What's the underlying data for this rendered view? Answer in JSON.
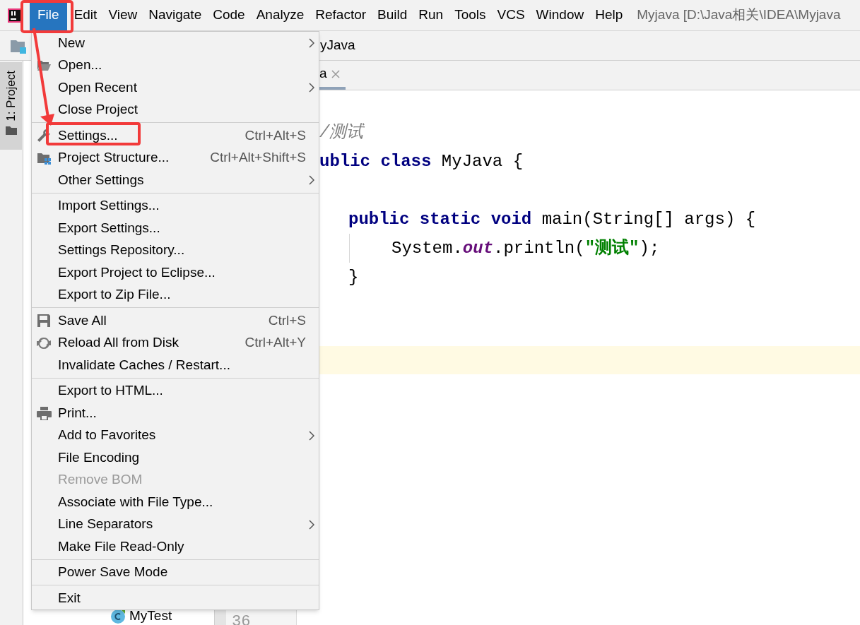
{
  "window": {
    "title": "Myjava [D:\\Java相关\\IDEA\\Myjava"
  },
  "menu_bar": [
    {
      "label": "File",
      "selected": true
    },
    {
      "label": "Edit",
      "selected": false
    },
    {
      "label": "View",
      "selected": false
    },
    {
      "label": "Navigate",
      "selected": false
    },
    {
      "label": "Code",
      "selected": false
    },
    {
      "label": "Analyze",
      "selected": false
    },
    {
      "label": "Refactor",
      "selected": false
    },
    {
      "label": "Build",
      "selected": false
    },
    {
      "label": "Run",
      "selected": false
    },
    {
      "label": "Tools",
      "selected": false
    },
    {
      "label": "VCS",
      "selected": false
    },
    {
      "label": "Window",
      "selected": false
    },
    {
      "label": "Help",
      "selected": false
    }
  ],
  "breadcrumb": "yJava",
  "editor_tab": {
    "label": "a"
  },
  "tool_window_tab": {
    "label": "1: Project"
  },
  "project_tree": [
    {
      "label": "MyTest"
    }
  ],
  "gutter": {
    "line_number": "36"
  },
  "code_lines": [
    {
      "kind": "code",
      "tokens": [
        {
          "kind": "comment",
          "text": "/测试"
        }
      ]
    },
    {
      "kind": "code",
      "tokens": [
        {
          "kind": "keyword",
          "text": "ublic class"
        },
        {
          "kind": "plain",
          "text": " MyJava {"
        }
      ],
      "children": [
        {
          "kind": "blank"
        },
        {
          "kind": "code",
          "tokens": [
            {
              "kind": "keyword",
              "text": "public static void"
            },
            {
              "kind": "plain",
              "text": " main(String[] args) {"
            }
          ],
          "children": [
            {
              "kind": "code",
              "tokens": [
                {
                  "kind": "plain",
                  "text": "System."
                },
                {
                  "kind": "static_field",
                  "text": "out"
                },
                {
                  "kind": "plain",
                  "text": ".println("
                },
                {
                  "kind": "string",
                  "text": "\"测试\""
                },
                {
                  "kind": "plain",
                  "text": ");"
                }
              ]
            }
          ]
        },
        {
          "kind": "code",
          "tokens": [
            {
              "kind": "plain",
              "text": "}"
            }
          ]
        }
      ]
    }
  ],
  "file_menu": [
    {
      "kind": "item",
      "label": "New",
      "submenu": true,
      "disabled": false
    },
    {
      "kind": "item",
      "label": "Open...",
      "submenu": false,
      "disabled": false
    },
    {
      "kind": "item",
      "label": "Open Recent",
      "submenu": true,
      "disabled": false
    },
    {
      "kind": "item",
      "label": "Close Project",
      "submenu": false,
      "disabled": false
    },
    {
      "kind": "separator"
    },
    {
      "kind": "item",
      "label": "Settings...",
      "shortcut": "Ctrl+Alt+S",
      "submenu": false,
      "disabled": false
    },
    {
      "kind": "item",
      "label": "Project Structure...",
      "shortcut": "Ctrl+Alt+Shift+S",
      "submenu": false,
      "disabled": false
    },
    {
      "kind": "item",
      "label": "Other Settings",
      "submenu": true,
      "disabled": false
    },
    {
      "kind": "separator"
    },
    {
      "kind": "item",
      "label": "Import Settings...",
      "submenu": false,
      "disabled": false
    },
    {
      "kind": "item",
      "label": "Export Settings...",
      "submenu": false,
      "disabled": false
    },
    {
      "kind": "item",
      "label": "Settings Repository...",
      "submenu": false,
      "disabled": false
    },
    {
      "kind": "item",
      "label": "Export Project to Eclipse...",
      "submenu": false,
      "disabled": false
    },
    {
      "kind": "item",
      "label": "Export to Zip File...",
      "submenu": false,
      "disabled": false
    },
    {
      "kind": "separator"
    },
    {
      "kind": "item",
      "label": "Save All",
      "shortcut": "Ctrl+S",
      "submenu": false,
      "disabled": false
    },
    {
      "kind": "item",
      "label": "Reload All from Disk",
      "shortcut": "Ctrl+Alt+Y",
      "submenu": false,
      "disabled": false
    },
    {
      "kind": "item",
      "label": "Invalidate Caches / Restart...",
      "submenu": false,
      "disabled": false
    },
    {
      "kind": "separator"
    },
    {
      "kind": "item",
      "label": "Export to HTML...",
      "submenu": false,
      "disabled": false
    },
    {
      "kind": "item",
      "label": "Print...",
      "submenu": false,
      "disabled": false
    },
    {
      "kind": "item",
      "label": "Add to Favorites",
      "submenu": true,
      "disabled": false
    },
    {
      "kind": "item",
      "label": "File Encoding",
      "submenu": false,
      "disabled": false
    },
    {
      "kind": "item",
      "label": "Remove BOM",
      "submenu": false,
      "disabled": true
    },
    {
      "kind": "item",
      "label": "Associate with File Type...",
      "submenu": false,
      "disabled": false
    },
    {
      "kind": "item",
      "label": "Line Separators",
      "submenu": true,
      "disabled": false
    },
    {
      "kind": "item",
      "label": "Make File Read-Only",
      "submenu": false,
      "disabled": false
    },
    {
      "kind": "separator"
    },
    {
      "kind": "item",
      "label": "Power Save Mode",
      "submenu": false,
      "disabled": false
    },
    {
      "kind": "separator"
    },
    {
      "kind": "item",
      "label": "Exit",
      "submenu": false,
      "disabled": false
    }
  ]
}
